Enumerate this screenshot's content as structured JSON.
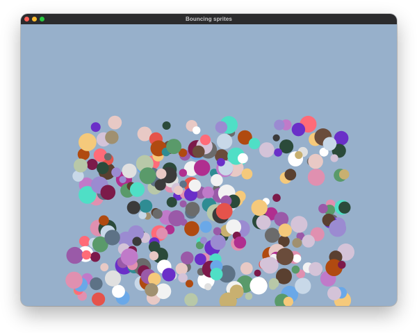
{
  "window": {
    "title": "Bouncing sprites",
    "background_color": "#97b0cb",
    "controls": [
      "close-icon",
      "minimize-icon",
      "maximize-icon"
    ]
  },
  "sprites": {
    "shape": "circle",
    "palette": [
      "#d4c3d8",
      "#f2f2f2",
      "#2f8c93",
      "#3b3b3b",
      "#6b6b6b",
      "#b02e8f",
      "#e5534b",
      "#6a4c3b",
      "#5a9a6a",
      "#9b8bd1",
      "#c07ac9",
      "#e8c9c5",
      "#f5c97b",
      "#6aa8e8",
      "#2b4a3a",
      "#7c1a4a",
      "#a09070",
      "#ffffff",
      "#e0e0e0",
      "#9a5aa8",
      "#5d7286",
      "#4fdfc6",
      "#c8b070",
      "#6a2fc8",
      "#b04a10",
      "#e090b0",
      "#5a4030",
      "#b8c8a8",
      "#c8d8e8",
      "#ff6b78"
    ]
  }
}
